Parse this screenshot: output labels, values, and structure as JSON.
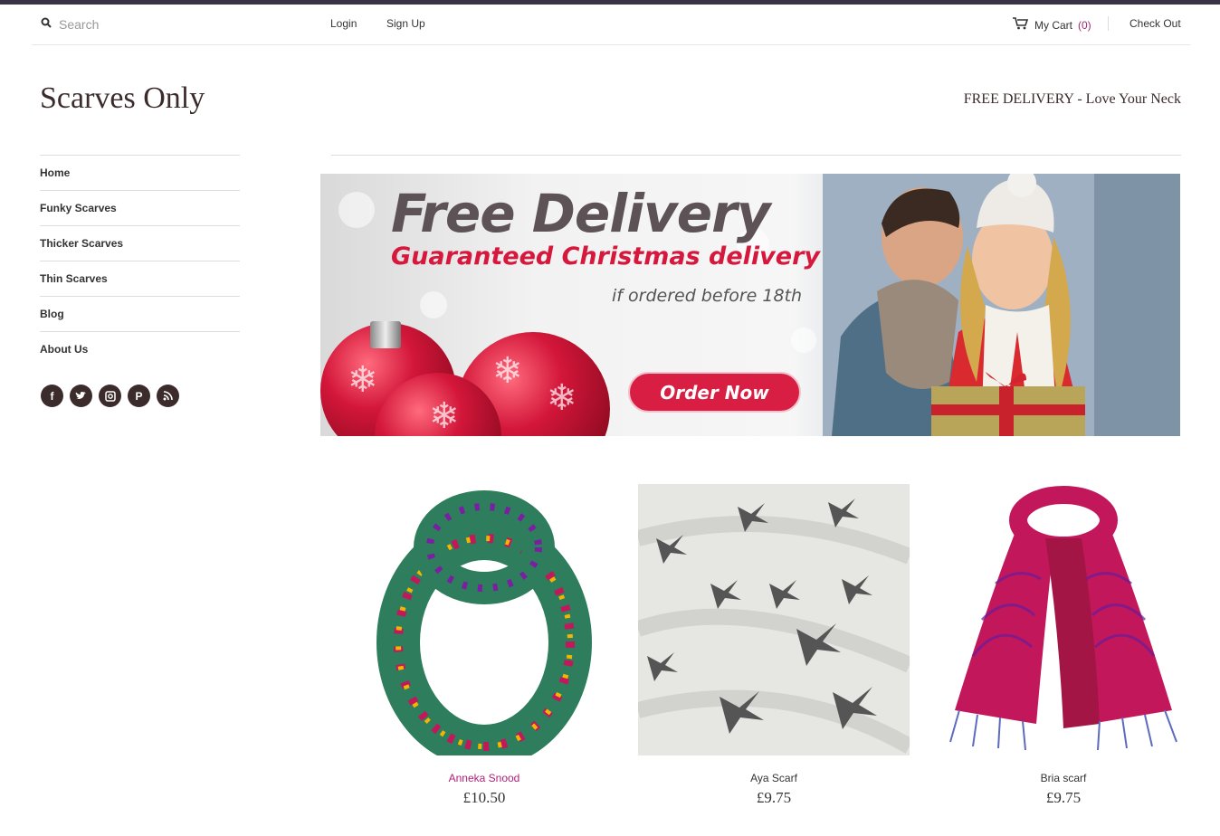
{
  "header": {
    "search_placeholder": "Search",
    "login": "Login",
    "signup": "Sign Up",
    "cart_label": "My Cart",
    "cart_count": "(0)",
    "checkout": "Check Out"
  },
  "brand": {
    "name": "Scarves Only",
    "tagline": "FREE DELIVERY - Love Your Neck"
  },
  "nav": {
    "items": [
      "Home",
      "Funky Scarves",
      "Thicker Scarves",
      "Thin Scarves",
      "Blog",
      "About Us"
    ]
  },
  "social": [
    "facebook-icon",
    "twitter-icon",
    "instagram-icon",
    "pinterest-icon",
    "rss-icon"
  ],
  "banner": {
    "title": "Free Delivery",
    "subtitle": "Guaranteed Christmas delivery",
    "note": "if ordered before 18th",
    "button": "Order Now"
  },
  "products": [
    {
      "name": "Anneka Snood",
      "price": "£10.50"
    },
    {
      "name": "Aya Scarf",
      "price": "£9.75"
    },
    {
      "name": "Bria scarf",
      "price": "£9.75"
    }
  ],
  "colors": {
    "brand_dark": "#3c2b2b",
    "accent": "#d81f43",
    "link_highlight": "#b0207a",
    "topbar": "#3a3346"
  }
}
